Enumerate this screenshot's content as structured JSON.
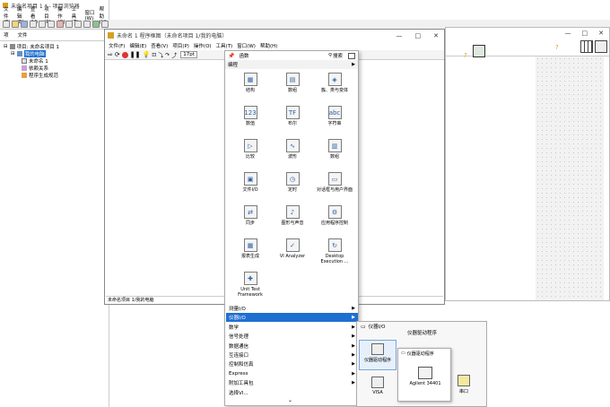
{
  "project_window": {
    "title": "未命名项目 1 * - 项目浏览器",
    "menu": [
      "文件(F)",
      "编辑(E)",
      "查看(V)",
      "项目(P)",
      "操作(O)",
      "工具(T)",
      "窗口(W)",
      "帮助(H)"
    ],
    "tabs": [
      "项",
      "文件"
    ],
    "tree": [
      {
        "label": "项目: 未命名项目 1",
        "level": 0
      },
      {
        "label": "我的电脑",
        "level": 1,
        "selected": true
      },
      {
        "label": "未命名 1",
        "level": 2
      },
      {
        "label": "依赖关系",
        "level": 2
      },
      {
        "label": "程序生成规范",
        "level": 2
      }
    ]
  },
  "diagram_window": {
    "title": "未命名 1 程序框图（未命名项目 1/我的电脑）",
    "menu": [
      "文件(F)",
      "编辑(E)",
      "查看(V)",
      "项目(P)",
      "操作(O)",
      "工具(T)",
      "窗口(W)",
      "帮助(H)"
    ],
    "font_value": "17pt",
    "status": "未命名项目 1/我的电脑",
    "controls": [
      "—",
      "□",
      "✕"
    ]
  },
  "front_panel_controls": [
    "—",
    "□",
    "✕"
  ],
  "palette": {
    "search_label": "搜索",
    "pin_label": "函数",
    "section": "编程",
    "items": [
      {
        "label": "结构",
        "icon": "structure-icon",
        "glyph": "▦"
      },
      {
        "label": "数组",
        "icon": "array-icon",
        "glyph": "▤"
      },
      {
        "label": "簇、类与变体",
        "icon": "cluster-icon",
        "glyph": "◈"
      },
      {
        "label": "数值",
        "icon": "numeric-icon",
        "glyph": "123"
      },
      {
        "label": "布尔",
        "icon": "boolean-icon",
        "glyph": "TF"
      },
      {
        "label": "字符串",
        "icon": "string-icon",
        "glyph": "abc"
      },
      {
        "label": "比较",
        "icon": "comparison-icon",
        "glyph": "▷"
      },
      {
        "label": "波形",
        "icon": "waveform-icon",
        "glyph": "∿"
      },
      {
        "label": "数组",
        "icon": "array-icon",
        "glyph": "▥"
      },
      {
        "label": "文件I/O",
        "icon": "file-io-icon",
        "glyph": "▣"
      },
      {
        "label": "定时",
        "icon": "timing-icon",
        "glyph": "◷"
      },
      {
        "label": "对话框与用户界面",
        "icon": "dialog-icon",
        "glyph": "▭"
      },
      {
        "label": "同步",
        "icon": "sync-icon",
        "glyph": "⇄"
      },
      {
        "label": "图形与声音",
        "icon": "graphics-icon",
        "glyph": "♪"
      },
      {
        "label": "应用程序控制",
        "icon": "app-control-icon",
        "glyph": "⚙"
      },
      {
        "label": "报表生成",
        "icon": "report-icon",
        "glyph": "▦"
      },
      {
        "label": "VI Analyzer",
        "icon": "vi-analyzer-icon",
        "glyph": "✓"
      },
      {
        "label": "Desktop Execution ...",
        "icon": "desktop-exec-icon",
        "glyph": "↻"
      },
      {
        "label": "Unit Test Framework",
        "icon": "unit-test-icon",
        "glyph": "✚"
      }
    ],
    "categories": [
      "测量I/O",
      "仪器I/O",
      "数学",
      "信号处理",
      "数据通信",
      "互连接口",
      "控制和仿真",
      "Express",
      "附加工具包",
      "选择VI..."
    ],
    "selected_category": "仪器I/O",
    "scroll_arrow": "⌄"
  },
  "instrument_palette": {
    "title": "仪器I/O",
    "items": [
      {
        "label": "仪器驱动程序",
        "icon": "instrument-driver-icon"
      },
      {
        "label": "VISA",
        "icon": "visa-icon"
      },
      {
        "label": "串口",
        "icon": "serial-icon"
      }
    ]
  },
  "driver_palette": {
    "title": "仪器驱动程序",
    "sub_title": "仪器驱动程序",
    "items": [
      {
        "label": "Agilent 34401",
        "icon": "agilent-icon"
      }
    ]
  }
}
